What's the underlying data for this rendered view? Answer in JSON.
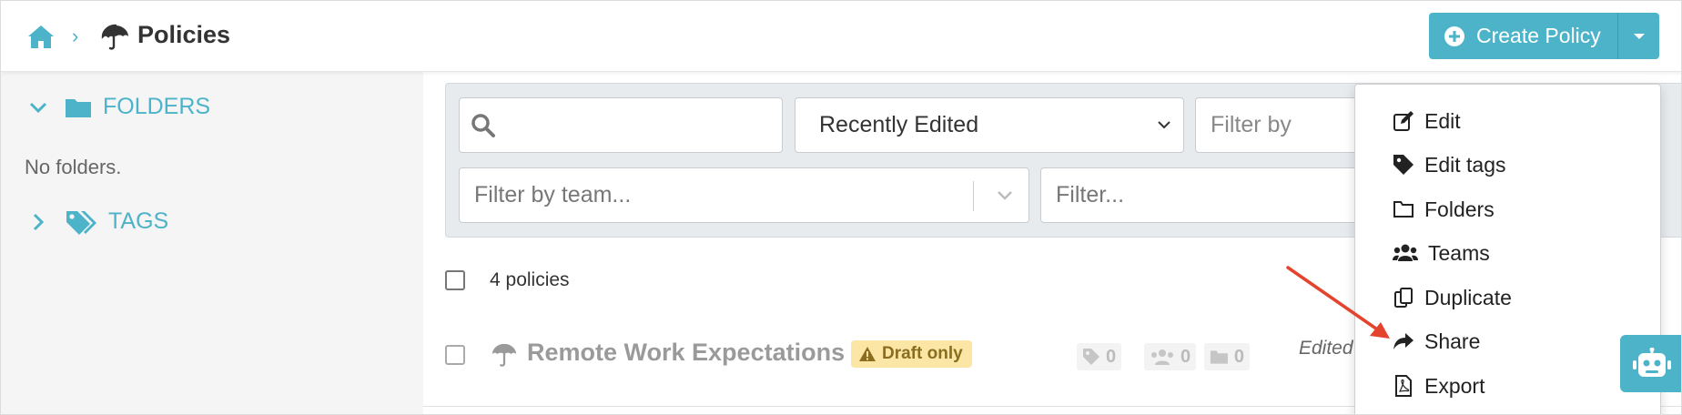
{
  "header": {
    "breadcrumb_separator": "›",
    "title": "Policies",
    "create_label": "Create Policy"
  },
  "sidebar": {
    "folders_label": "FOLDERS",
    "no_folders": "No folders.",
    "tags_label": "TAGS"
  },
  "filters": {
    "search_value": "",
    "sort_value": "Recently Edited",
    "filter_by_placeholder": "Filter by",
    "team_placeholder": "Filter by team...",
    "filter_placeholder": "Filter..."
  },
  "list": {
    "count_label": "4 policies",
    "rows": [
      {
        "title": "Remote Work Expectations",
        "badge": "Draft only",
        "tags_count": "0",
        "teams_count": "0",
        "folders_count": "0",
        "edited": "Edited"
      }
    ]
  },
  "menu": {
    "items": [
      {
        "label": "Edit",
        "icon": "edit-icon"
      },
      {
        "label": "Edit tags",
        "icon": "tag-icon"
      },
      {
        "label": "Folders",
        "icon": "folder-icon"
      },
      {
        "label": "Teams",
        "icon": "users-icon"
      },
      {
        "label": "Duplicate",
        "icon": "copy-icon"
      },
      {
        "label": "Share",
        "icon": "share-icon"
      },
      {
        "label": "Export",
        "icon": "pdf-file-icon"
      }
    ]
  },
  "colors": {
    "accent": "#4db3c9",
    "draft_badge_bg": "#fbe6a6",
    "annotation_arrow": "#e4432d"
  }
}
